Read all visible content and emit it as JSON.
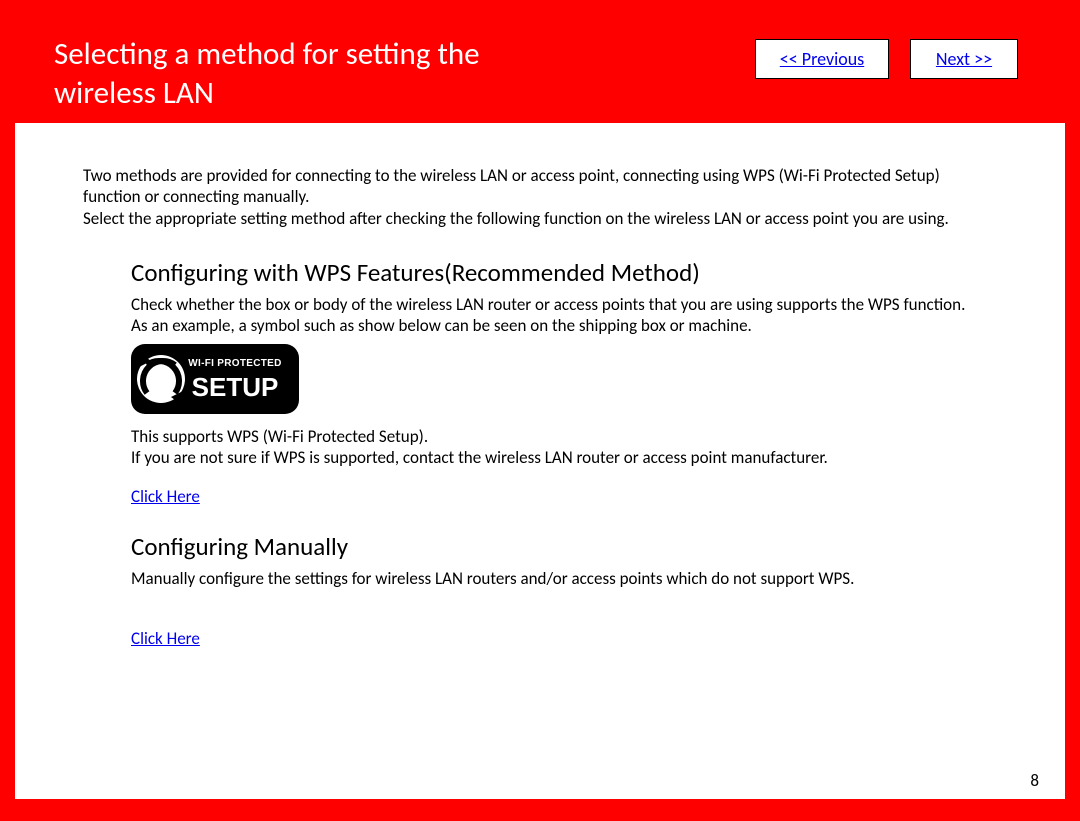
{
  "header": {
    "title": "Selecting a method for setting the wireless LAN",
    "prev_label": "<< Previous",
    "next_label": "Next >>"
  },
  "intro": {
    "p1": "Two methods are provided for connecting to the wireless LAN or access point, connecting using WPS (Wi-Fi Protected Setup) function or connecting manually.",
    "p2": "Select the appropriate setting method after checking the following function on the wireless LAN or access point you are using."
  },
  "wps_section": {
    "heading": "Configuring with WPS Features(Recommended Method)",
    "p1": "Check whether the box or body of the wireless LAN router or access points that you are using supports the WPS function.",
    "p2": "As an example, a symbol such as show below can be seen on the shipping box or machine.",
    "p3": "This supports WPS (Wi-Fi Protected Setup).",
    "p4": "If you are not sure if WPS is supported, contact the wireless LAN router or access point manufacturer.",
    "link": "Click Here",
    "logo_top": "WI-FI PROTECTED",
    "logo_bottom": "SETUP"
  },
  "manual_section": {
    "heading": "Configuring Manually",
    "p1": "Manually configure the settings for wireless LAN routers and/or access points which do not support WPS.",
    "link": "Click Here"
  },
  "page_number": "8"
}
